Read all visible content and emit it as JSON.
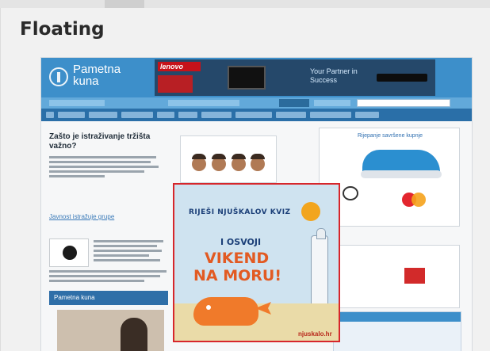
{
  "card": {
    "title": "Floating"
  },
  "site": {
    "logo_text": "Pametna kuna",
    "ad": {
      "brand": "lenovo",
      "text": "Your Partner in Success"
    },
    "article": {
      "title": "Zašto je istraživanje tržišta važno?",
      "link": "Javnost istražuje grupe"
    },
    "right_card_title": "Rijepanje savršene kupnje",
    "video_caption": "Pametna kuna"
  },
  "popup": {
    "title": "RIJEŠI NJUŠKALOV KVIZ",
    "line1": "I OSVOJI",
    "line2": "VIKEND",
    "line3": "NA MORU!",
    "brand": "njuskalo.hr"
  }
}
